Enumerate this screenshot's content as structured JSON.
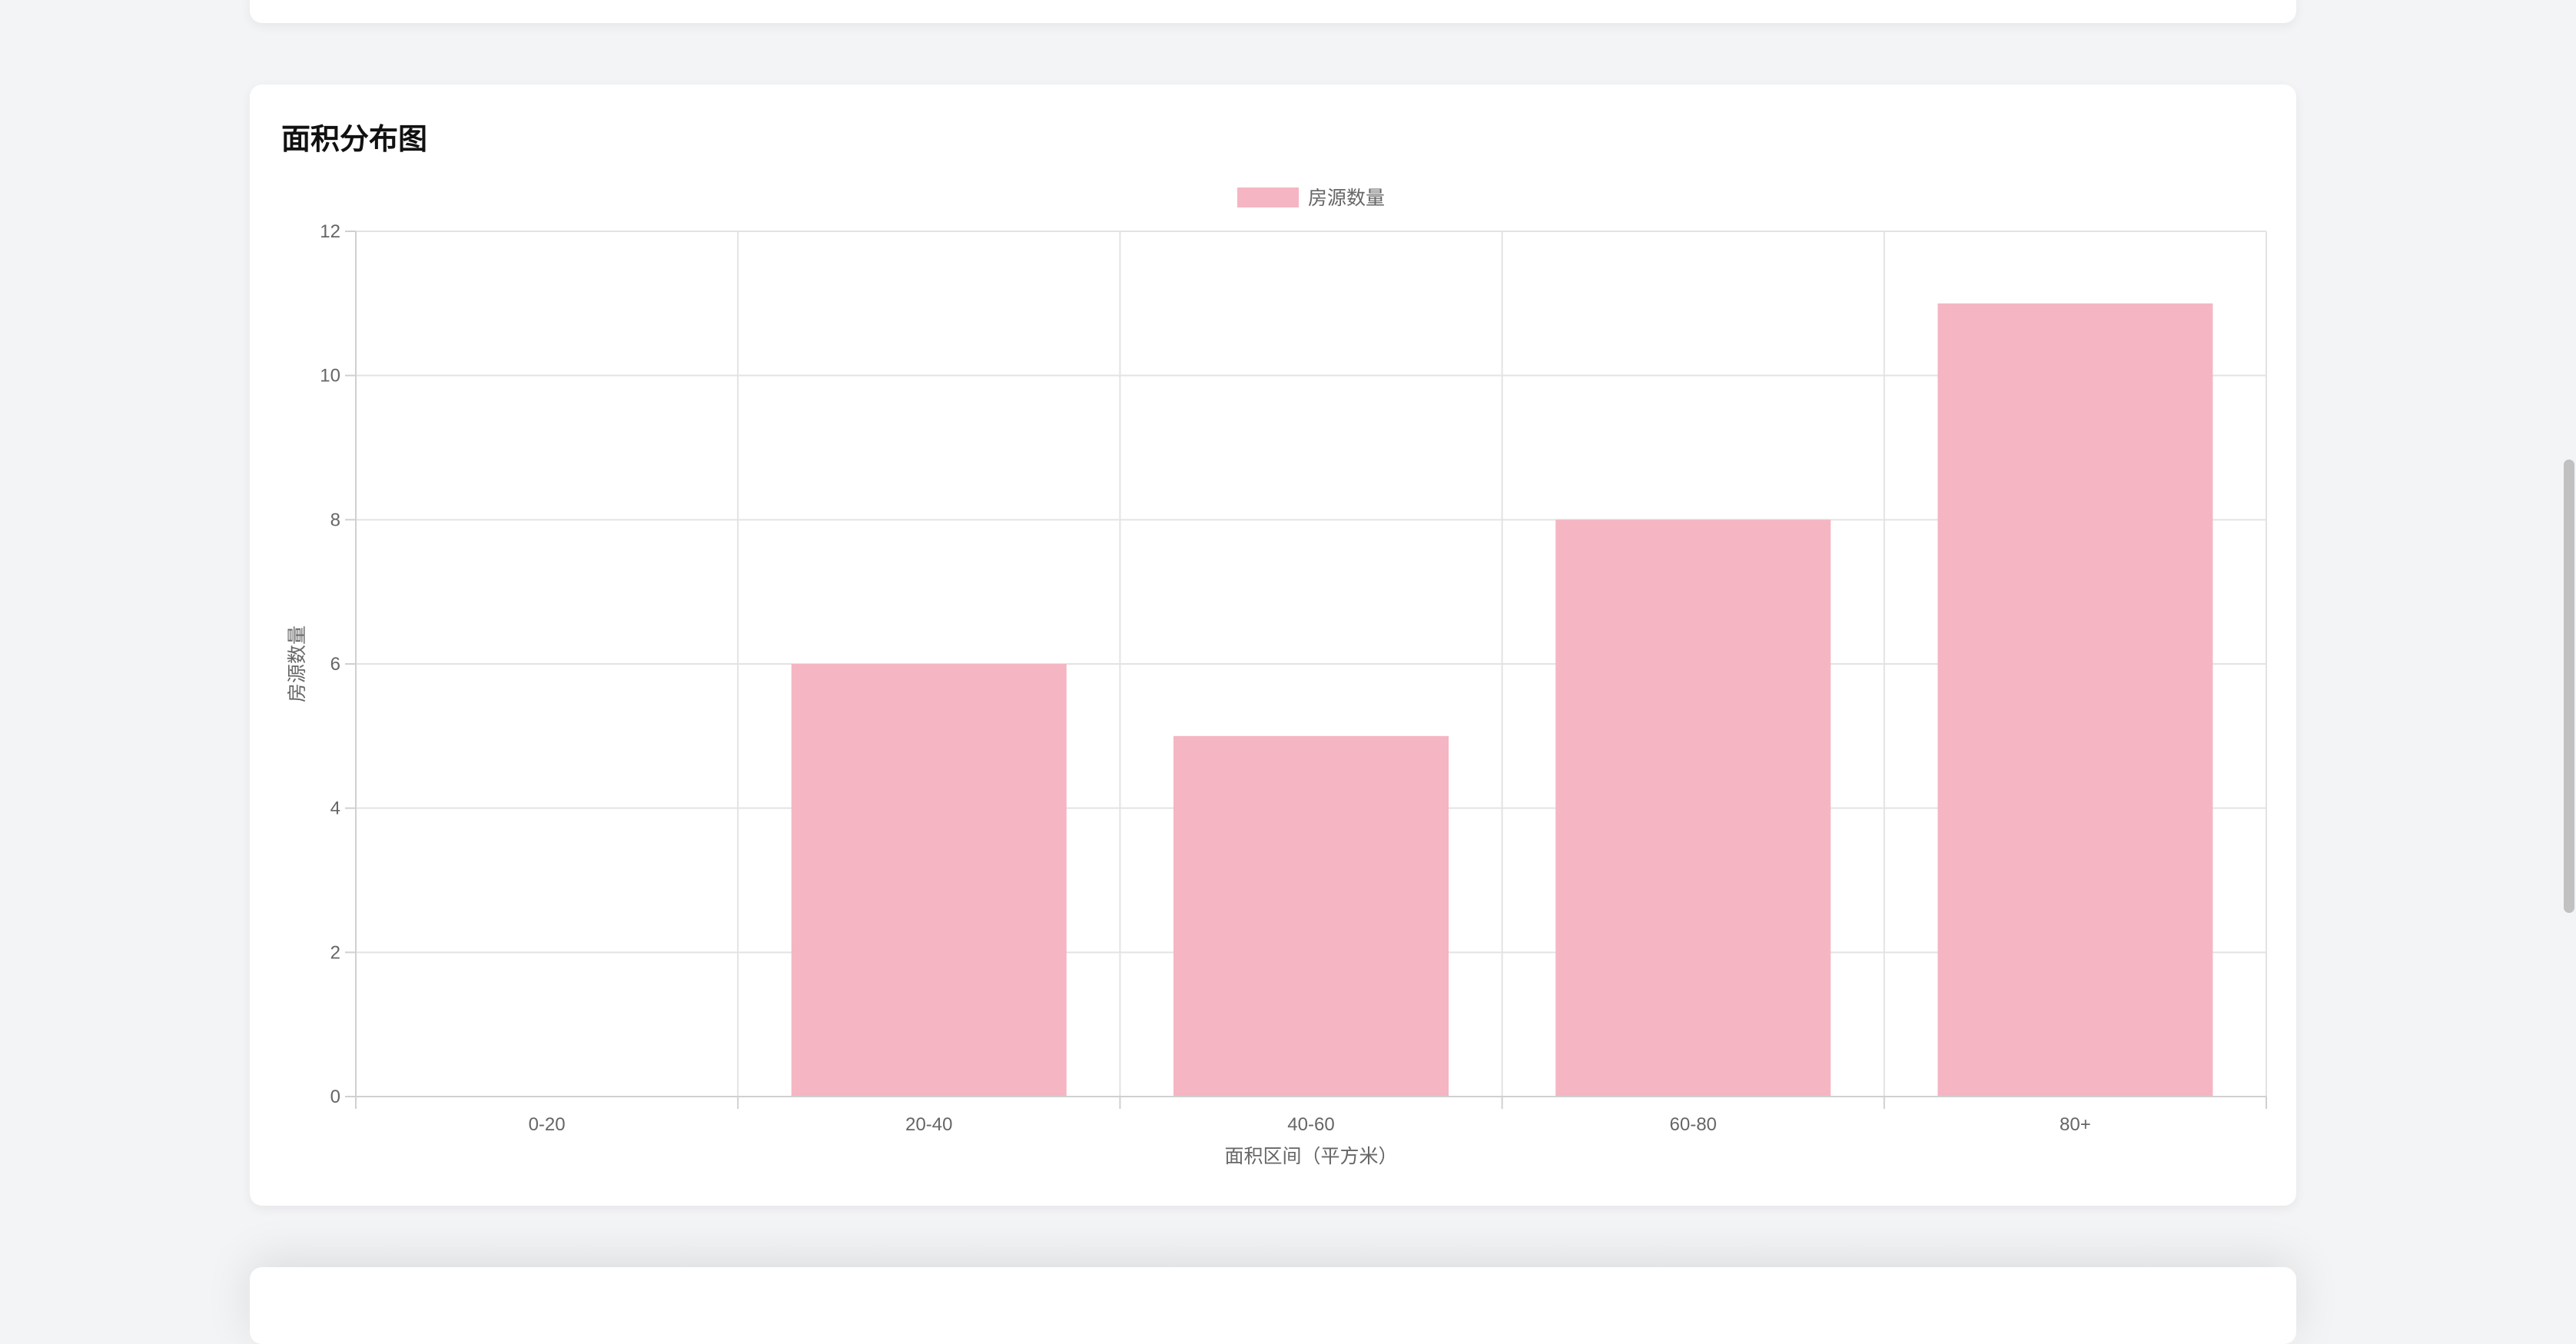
{
  "section": {
    "title": "面积分布图"
  },
  "chart_data": {
    "type": "bar",
    "categories": [
      "0-20",
      "20-40",
      "40-60",
      "60-80",
      "80+"
    ],
    "series": [
      {
        "name": "房源数量",
        "values": [
          0,
          6,
          5,
          8,
          11
        ],
        "color": "#f5b5c3"
      }
    ],
    "xlabel": "面积区间（平方米）",
    "ylabel": "房源数量",
    "ylim": [
      0,
      12
    ],
    "yticks": [
      0,
      2,
      4,
      6,
      8,
      10,
      12
    ],
    "grid": true,
    "legend": "top-center"
  }
}
